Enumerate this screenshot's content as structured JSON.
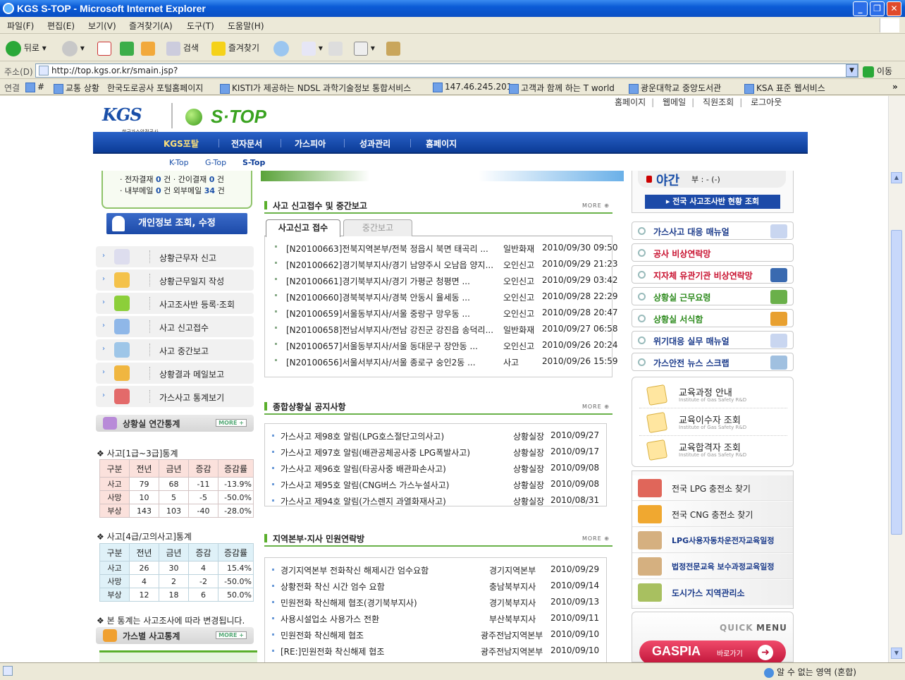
{
  "window": {
    "title": "KGS S-TOP - Microsoft Internet Explorer"
  },
  "menu": [
    "파일(F)",
    "편집(E)",
    "보기(V)",
    "즐겨찾기(A)",
    "도구(T)",
    "도움말(H)"
  ],
  "toolbar": {
    "back": "뒤로",
    "search": "검색",
    "favorites": "즐겨찾기"
  },
  "address": {
    "label": "주소(D)",
    "url": "http://top.kgs.or.kr/smain.jsp?",
    "go": "이동"
  },
  "links": {
    "label": "연결",
    "items": [
      "#",
      "교통 상황",
      "한국도로공사 포털홈페이지",
      "KISTI가 제공하는 NDSL 과학기술정보 통합서비스",
      "147.46.245.201",
      "고객과 함께 하는 T world",
      "광운대학교 중앙도서관",
      "KSA 표준 웹서비스"
    ]
  },
  "site": {
    "toplinks": [
      "홈페이지",
      "웹메일",
      "직원조회",
      "로그아웃"
    ],
    "kgs_logo": "KGS",
    "kgs_sub": "한국가스안전공사",
    "stop_logo": "S·TOP",
    "nav": [
      "KGS포탈",
      "전자문서",
      "가스피아",
      "성과관리",
      "홈페이지"
    ],
    "subnav": [
      "K-Top",
      "G-Top",
      "S-Top"
    ]
  },
  "left": {
    "approval_line1": [
      "· 전자결재",
      "0",
      "건 · 간이결재",
      "0",
      "건"
    ],
    "approval_line2": [
      "· 내부메일",
      "0",
      "건",
      "외부메일",
      "34",
      "건"
    ],
    "profile_button": "개인정보 조회, 수정",
    "menu": [
      "상황근무자 신고",
      "상황근무일지 작성",
      "사고조사반 등록·조회",
      "사고 신고접수",
      "사고 중간보고",
      "상황결과 메일보고",
      "가스사고 통계보기"
    ],
    "annual_stats": "상황실 연간통계",
    "more": "MORE +",
    "table1_title": "❖ 사고[1급~3급]통계",
    "table2_title": "❖ 사고[4급/고의사고]통계",
    "headers": [
      "구분",
      "전년",
      "금년",
      "증감",
      "증감률"
    ],
    "table1": [
      [
        "사고",
        "79",
        "68",
        "-11",
        "-13.9%"
      ],
      [
        "사망",
        "10",
        "5",
        "-5",
        "-50.0%"
      ],
      [
        "부상",
        "143",
        "103",
        "-40",
        "-28.0%"
      ]
    ],
    "table2": [
      [
        "사고",
        "26",
        "30",
        "4",
        "15.4%"
      ],
      [
        "사망",
        "4",
        "2",
        "-2",
        "-50.0%"
      ],
      [
        "부상",
        "12",
        "18",
        "6",
        "50.0%"
      ]
    ],
    "note": "❖ 본 통계는 사고조사에 따라 변경됩니다.",
    "gas_stats": "가스별 사고통계"
  },
  "middle": {
    "accident_head": "사고 신고접수 및 중간보고",
    "more": "MORE",
    "tab_on": "사고신고 접수",
    "tab_off": "중간보고",
    "accidents": [
      [
        "[N20100663]전북지역본부/전북 정읍시 북면 태곡리 ...",
        "일반화재",
        "2010/09/30 09:50"
      ],
      [
        "[N20100662]경기북부지사/경기 남양주시 오남읍 양지...",
        "오인신고",
        "2010/09/29 21:23"
      ],
      [
        "[N20100661]경기북부지사/경기 가평군 청평면 ...",
        "오인신고",
        "2010/09/29 03:42"
      ],
      [
        "[N20100660]경북북부지사/경북 안동시 율세동 ...",
        "오인신고",
        "2010/09/28 22:29"
      ],
      [
        "[N20100659]서울동부지사/서울 중랑구 망우동 ...",
        "오인신고",
        "2010/09/28 20:47"
      ],
      [
        "[N20100658]전남서부지사/전남 강진군 강진읍 송덕리...",
        "일반화재",
        "2010/09/27 06:58"
      ],
      [
        "[N20100657]서울동부지사/서울 동대문구 장안동 ...",
        "오인신고",
        "2010/09/26 20:24"
      ],
      [
        "[N20100656]서울서부지사/서울 종로구 숭인2동 ...",
        "사고",
        "2010/09/26 15:59"
      ]
    ],
    "notice_head": "종합상황실 공지사항",
    "notices": [
      [
        "가스사고 제98호 알림(LPG호스절단고의사고)",
        "상황실장",
        "2010/09/27"
      ],
      [
        "가스사고 제97호 알림(배관공체공사중 LPG폭발사고)",
        "상황실장",
        "2010/09/17"
      ],
      [
        "가스사고 제96호 알림(타공사중 배관파손사고)",
        "상황실장",
        "2010/09/08"
      ],
      [
        "가스사고 제95호 알림(CNG버스 가스누설사고)",
        "상황실장",
        "2010/09/08"
      ],
      [
        "가스사고 제94호 알림(가스렌지 과열화재사고)",
        "상황실장",
        "2010/08/31"
      ]
    ],
    "region_head": "지역본부·지사 민원연락방",
    "regions": [
      [
        "경기지역본부 전화착신 해제시간 엄수요함",
        "경기지역본부",
        "2010/09/29"
      ],
      [
        "상황전화 착신 시간 엄수 요함",
        "충남북부지사",
        "2010/09/14"
      ],
      [
        "민원전화 착신해제 협조(경기북부지사)",
        "경기북부지사",
        "2010/09/13"
      ],
      [
        "사용시설업소 사용가스 전환",
        "부산북부지사",
        "2010/09/11"
      ],
      [
        "민원전화 착신해제 협조",
        "광주전남지역본부",
        "2010/09/10"
      ],
      [
        "[RE:]민원전화 착신해제 협조",
        "광주전남지역본부",
        "2010/09/10"
      ]
    ]
  },
  "right": {
    "night": "야간",
    "night_value": "부 : - (-)",
    "status_button": "전국 사고조사반 현황 조회",
    "quicklinks": [
      "가스사고 대응 매뉴얼",
      "공사 비상연락망",
      "지자체 유관기관 비상연락망",
      "상황실 근무요령",
      "상황실 서식함",
      "위기대응 실무 매뉴얼",
      "가스안전 뉴스 스크랩"
    ],
    "quicklink_colors": [
      "#1a3a8a",
      "#c8102e",
      "#c8102e",
      "#2e8b1e",
      "#2e8b1e",
      "#1a3a8a",
      "#1a3a8a"
    ],
    "edu": [
      {
        "label": "교육과정 안내",
        "sub": "Institute of Gas Safety R&D"
      },
      {
        "label": "교육이수자 조회",
        "sub": "Institute of Gas Safety R&D"
      },
      {
        "label": "교육합격자 조회",
        "sub": "Institute of Gas Safety R&D"
      }
    ],
    "stations": [
      "전국 LPG 충전소 찾기",
      "전국 CNG 충전소 찾기",
      "LPG사용자동차운전자교육일정",
      "법정전문교육 보수과정교육일정",
      "도시가스 지역관리소"
    ],
    "quick1": "QUICK",
    "quick2": "MENU",
    "gaspia": "GASPIA",
    "gaspia_sub": "바로가기"
  },
  "status": {
    "zone": "알 수 없는 영역 (혼합)"
  }
}
